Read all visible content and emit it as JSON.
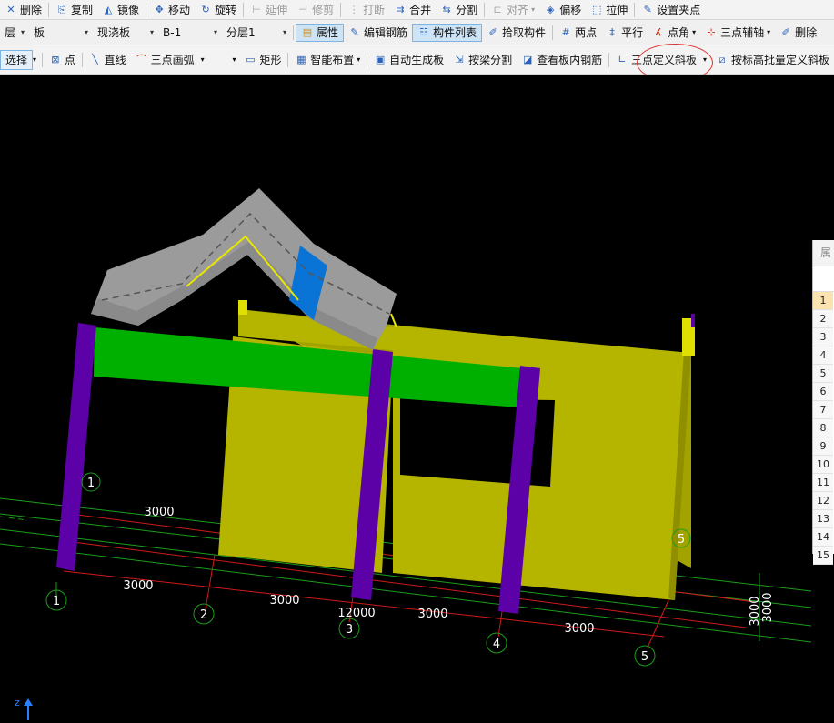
{
  "toolbar1": {
    "items": [
      {
        "icon": "delete-icon",
        "label": "删除",
        "disabled": false
      },
      {
        "icon": "copy-icon",
        "label": "复制",
        "disabled": false
      },
      {
        "icon": "mirror-icon",
        "label": "镜像",
        "disabled": false
      },
      {
        "icon": "move-icon",
        "label": "移动",
        "disabled": false
      },
      {
        "icon": "rotate-icon",
        "label": "旋转",
        "disabled": false
      },
      {
        "icon": "extend-icon",
        "label": "延伸",
        "disabled": true
      },
      {
        "icon": "trim-icon",
        "label": "修剪",
        "disabled": true
      },
      {
        "icon": "break-icon",
        "label": "打断",
        "disabled": true
      },
      {
        "icon": "merge-icon",
        "label": "合并",
        "disabled": false
      },
      {
        "icon": "split-icon",
        "label": "分割",
        "disabled": false
      },
      {
        "icon": "align-icon",
        "label": "对齐",
        "disabled": true
      },
      {
        "icon": "offset-icon",
        "label": "偏移",
        "disabled": false
      },
      {
        "icon": "stretch-icon",
        "label": "拉伸",
        "disabled": false
      },
      {
        "icon": "grip-icon",
        "label": "设置夹点",
        "disabled": false
      }
    ]
  },
  "toolbar2": {
    "layer": "层",
    "category": "板",
    "type": "现浇板",
    "component": "B-1",
    "sublayer": "分层1",
    "buttons": [
      {
        "icon": "properties-icon",
        "label": "属性",
        "active": true
      },
      {
        "icon": "edit-rebar-icon",
        "label": "编辑钢筋",
        "active": false
      },
      {
        "icon": "component-list-icon",
        "label": "构件列表",
        "active": true
      },
      {
        "icon": "pick-component-icon",
        "label": "拾取构件",
        "active": false
      },
      {
        "icon": "two-point-icon",
        "label": "两点",
        "active": false
      },
      {
        "icon": "parallel-icon",
        "label": "平行",
        "active": false
      },
      {
        "icon": "point-angle-icon",
        "label": "点角",
        "active": false
      },
      {
        "icon": "three-point-axis-icon",
        "label": "三点辅轴",
        "active": false
      },
      {
        "icon": "delete-aux-icon",
        "label": "删除",
        "active": false
      }
    ]
  },
  "toolbar3": {
    "select_label": "选择",
    "point_label": "点",
    "line_label": "直线",
    "arc_label": "三点画弧",
    "rect_label": "矩形",
    "smart_label": "智能布置",
    "auto_label": "自动生成板",
    "beam_split_label": "按梁分割",
    "view_rebar_label": "查看板内钢筋",
    "slope_label": "三点定义斜板",
    "batch_label": "按标高批量定义斜板"
  },
  "viewport": {
    "axis_labels": [
      "1",
      "2",
      "3",
      "4",
      "5"
    ],
    "dims_front": [
      "3000",
      "3000",
      "3000",
      "3000"
    ],
    "dim_back": "3000",
    "dim_total": "12000",
    "dim_side": "3000"
  },
  "properties": {
    "title": "属性",
    "rows": [
      "1",
      "2",
      "3",
      "4",
      "5",
      "6",
      "7",
      "8",
      "9",
      "10",
      "11",
      "12",
      "13",
      "14",
      "15"
    ]
  },
  "colors": {
    "wall": "#b5b500",
    "column": "#5c00a8",
    "beam": "#00b000",
    "slab": "#9b9b9b",
    "slab_selected": "#0a74d6",
    "axis_green": "#1a9e1a",
    "axis_red": "#d01a1a"
  }
}
